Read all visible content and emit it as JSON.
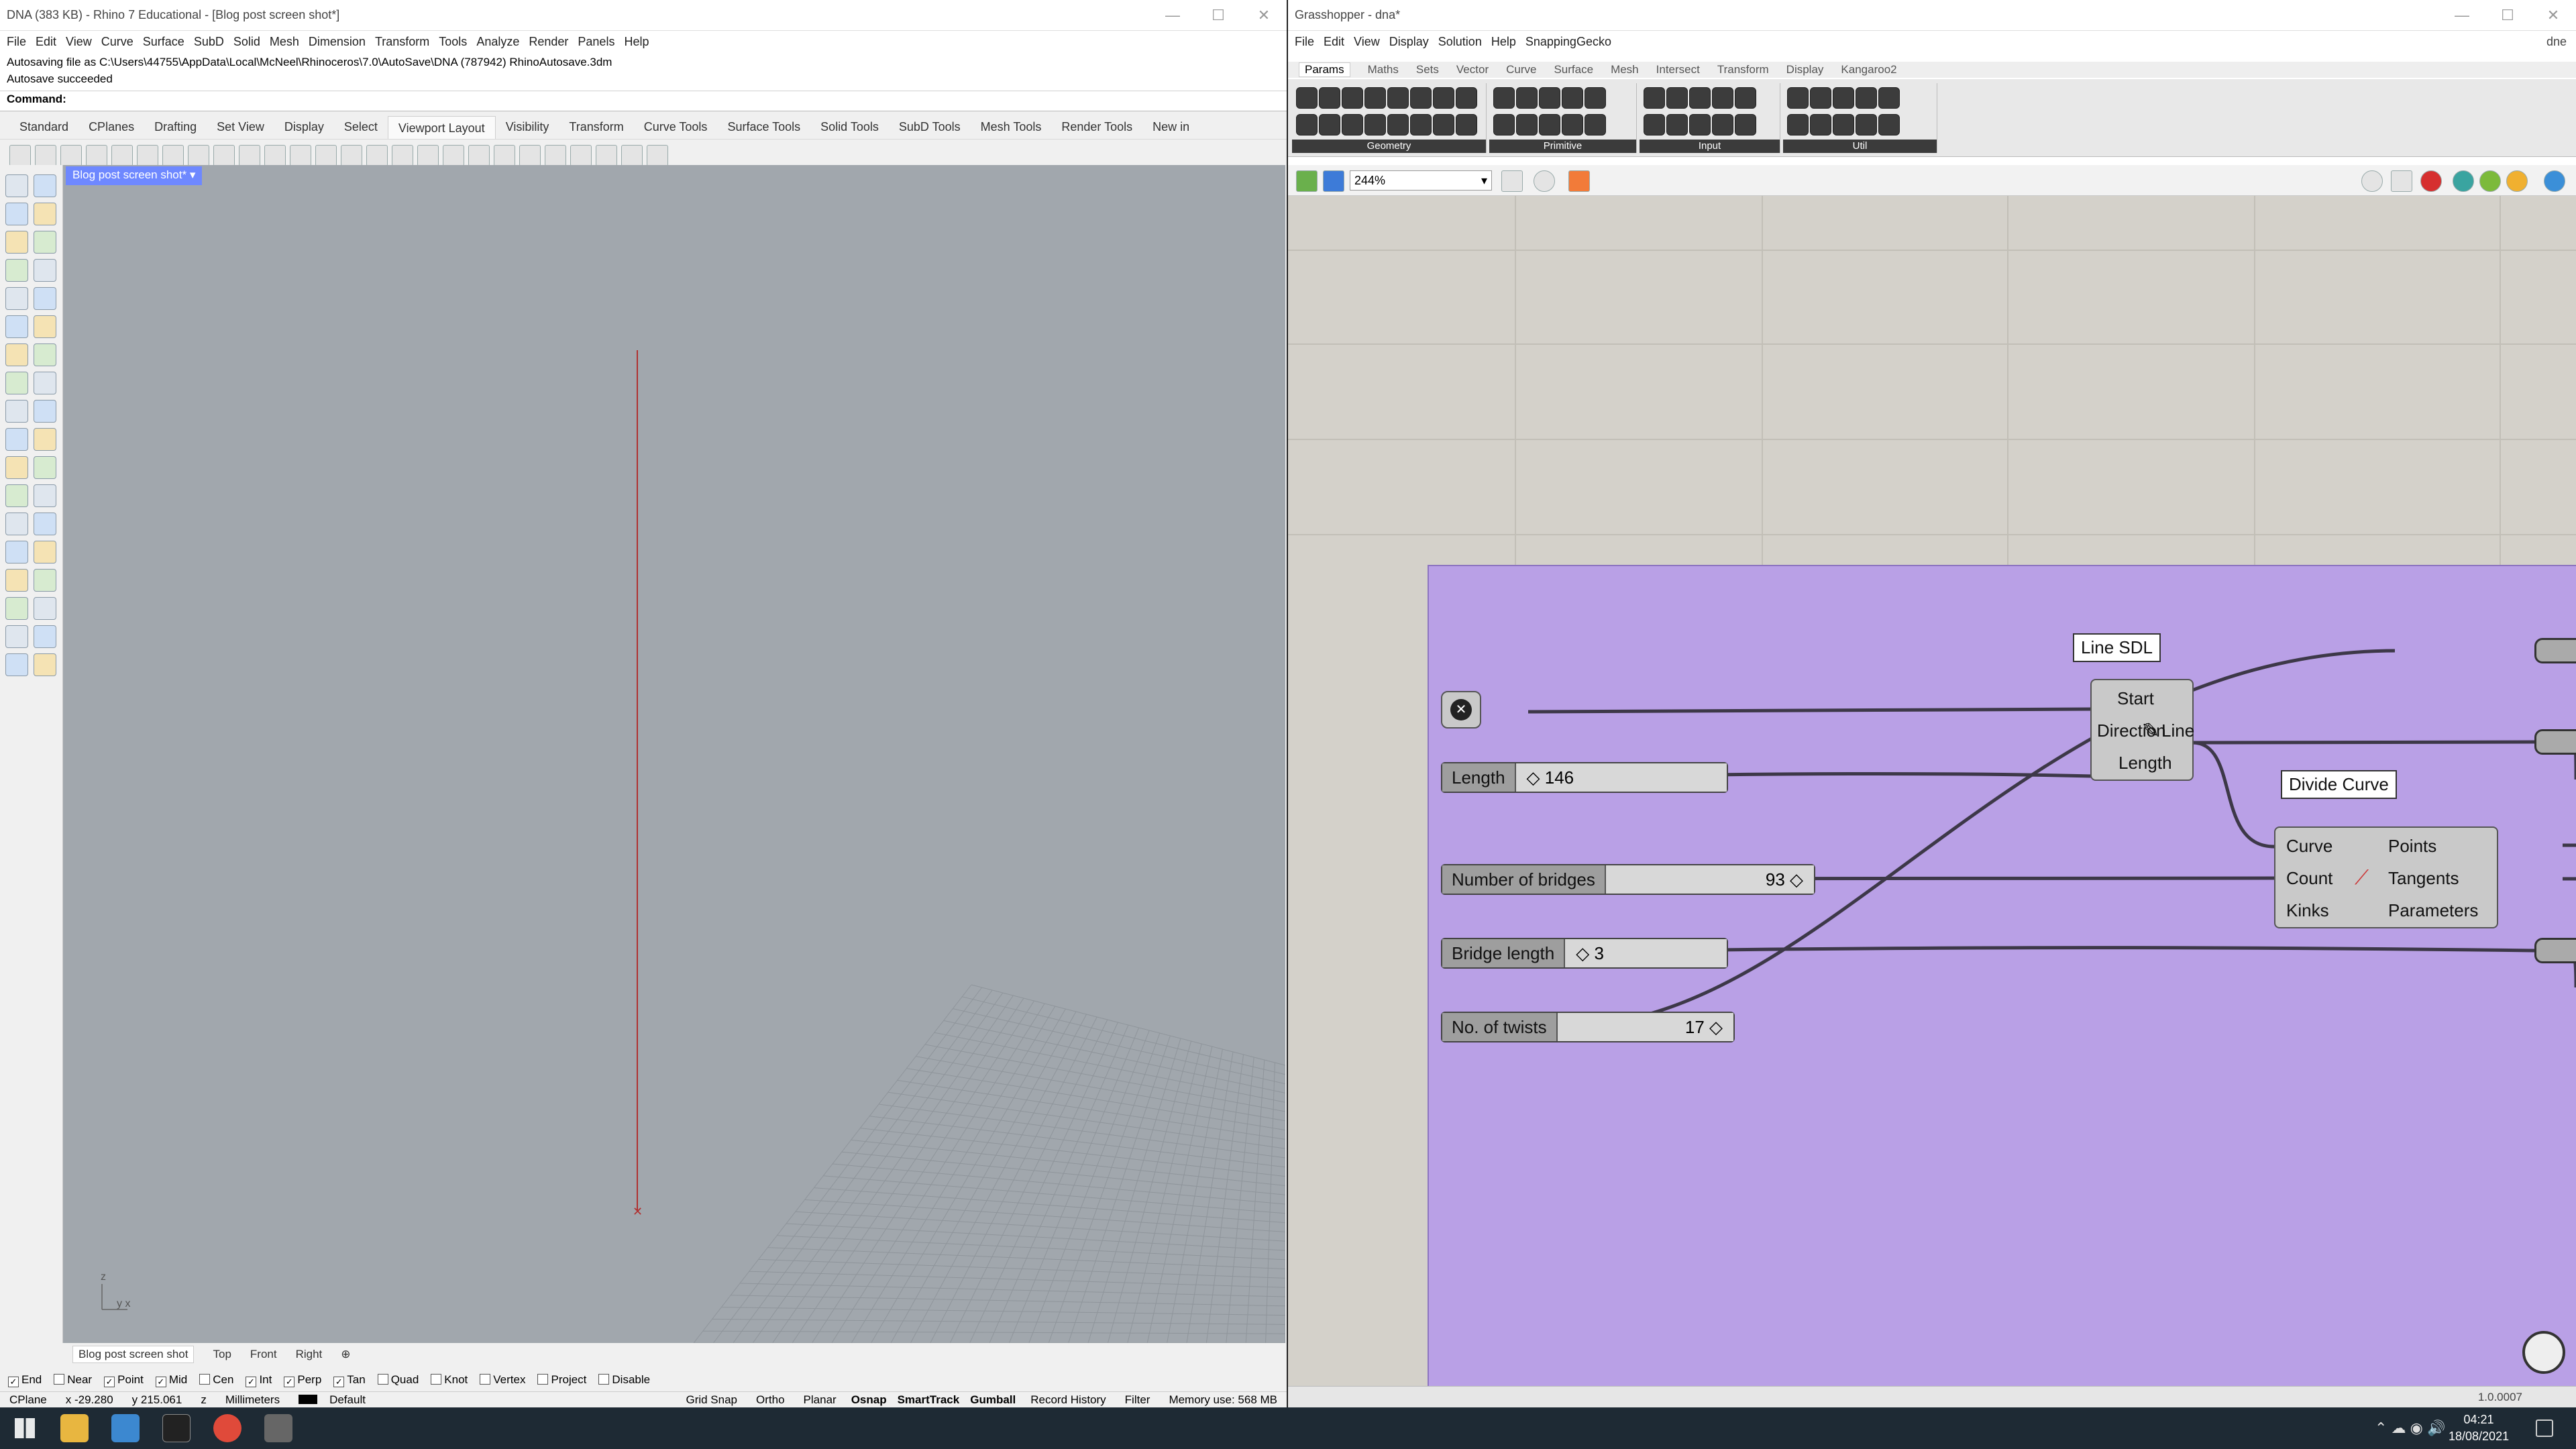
{
  "rhino": {
    "title": "DNA (383 KB) - Rhino 7 Educational - [Blog post screen shot*]",
    "menu": [
      "File",
      "Edit",
      "View",
      "Curve",
      "Surface",
      "SubD",
      "Solid",
      "Mesh",
      "Dimension",
      "Transform",
      "Tools",
      "Analyze",
      "Render",
      "Panels",
      "Help"
    ],
    "history": [
      "Autosaving file as C:\\Users\\44755\\AppData\\Local\\McNeel\\Rhinoceros\\7.0\\AutoSave\\DNA (787942) RhinoAutosave.3dm",
      "Autosave succeeded"
    ],
    "command_label": "Command:",
    "toolbar_tabs": [
      "Standard",
      "CPlanes",
      "Drafting",
      "Set View",
      "Display",
      "Select",
      "Viewport Layout",
      "Visibility",
      "Transform",
      "Curve Tools",
      "Surface Tools",
      "Solid Tools",
      "SubD Tools",
      "Mesh Tools",
      "Render Tools",
      "New in"
    ],
    "active_toolbar_tab": "Viewport Layout",
    "viewport_name": "Blog post screen shot*",
    "axis_labels": {
      "z": "z",
      "yx": "y x"
    },
    "viewport_tabs": [
      "Blog post screen shot",
      "Top",
      "Front",
      "Right"
    ],
    "osnaps": [
      {
        "label": "End",
        "checked": true
      },
      {
        "label": "Near",
        "checked": false
      },
      {
        "label": "Point",
        "checked": true
      },
      {
        "label": "Mid",
        "checked": true
      },
      {
        "label": "Cen",
        "checked": false
      },
      {
        "label": "Int",
        "checked": true
      },
      {
        "label": "Perp",
        "checked": true
      },
      {
        "label": "Tan",
        "checked": true
      },
      {
        "label": "Quad",
        "checked": false
      },
      {
        "label": "Knot",
        "checked": false
      },
      {
        "label": "Vertex",
        "checked": false
      },
      {
        "label": "Project",
        "checked": false
      },
      {
        "label": "Disable",
        "checked": false
      }
    ],
    "status": {
      "cplane": "CPlane",
      "x": "x -29.280",
      "y": "y 215.061",
      "z": "z",
      "units": "Millimeters",
      "layer": "Default",
      "toggles": [
        "Grid Snap",
        "Ortho",
        "Planar",
        "Osnap",
        "SmartTrack",
        "Gumball",
        "Record History",
        "Filter"
      ],
      "bold_toggles": [
        "Osnap",
        "SmartTrack",
        "Gumball"
      ],
      "memory": "Memory use: 568 MB"
    }
  },
  "gh": {
    "title": "Grasshopper - dna*",
    "menu": [
      "File",
      "Edit",
      "View",
      "Display",
      "Solution",
      "Help",
      "SnappingGecko"
    ],
    "dock_label": "dne",
    "tabs": [
      "Params",
      "Maths",
      "Sets",
      "Vector",
      "Curve",
      "Surface",
      "Mesh",
      "Intersect",
      "Transform",
      "Display",
      "Kangaroo2"
    ],
    "active_tab": "Params",
    "panel_groups": [
      "Geometry",
      "Primitive",
      "Input",
      "Util"
    ],
    "zoom": "244%",
    "components": {
      "line_sdl": {
        "title": "Line SDL",
        "inputs": [
          "Start",
          "Direction",
          "Length"
        ],
        "output": "Line"
      },
      "divide_curve": {
        "title": "Divide Curve",
        "inputs": [
          "Curve",
          "Count",
          "Kinks"
        ],
        "outputs": [
          "Points",
          "Tangents",
          "Parameters"
        ]
      }
    },
    "sliders": [
      {
        "label": "Length",
        "value": "146"
      },
      {
        "label": "Number of bridges",
        "value": "93"
      },
      {
        "label": "Bridge length",
        "value": "3"
      },
      {
        "label": "No. of twists",
        "value": "17"
      }
    ],
    "status_version": "1.0.0007"
  },
  "taskbar": {
    "time": "04:21",
    "date": "18/08/2021"
  },
  "colors": {
    "group_fill": "#b9a0e6",
    "canvas_bg": "#d4d1ca",
    "viewport_bg": "#a1a7ad",
    "selected_curve": "#b03030"
  }
}
